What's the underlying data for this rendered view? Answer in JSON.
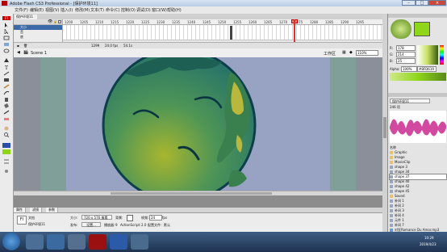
{
  "window": {
    "title": "Adobe Flash CS3 Professional - [保护环境11]"
  },
  "menu": [
    "文件(F)",
    "编辑(E)",
    "视图(V)",
    "插入(I)",
    "修改(M)",
    "文本(T)",
    "命令(C)",
    "控制(O)",
    "调试(D)",
    "窗口(W)",
    "帮助(H)"
  ],
  "document_tab": "保护环境11",
  "timeline": {
    "ticks": [
      "1200",
      "1205",
      "1210",
      "1215",
      "1220",
      "1225",
      "1230",
      "1235",
      "1240",
      "1245",
      "1250",
      "1255",
      "1260",
      "1265",
      "1270",
      "1275",
      "1280",
      "1285",
      "1290",
      "1295"
    ],
    "layers": [
      {
        "name": "大小"
      },
      {
        "name": "音"
      },
      {
        "name": "底"
      }
    ],
    "status": {
      "frame": "1299",
      "fps": "24.0 fps",
      "time": "54.1s"
    }
  },
  "editbar": {
    "scene": "Scene 1",
    "workspace": "工作区",
    "zoom": "110%"
  },
  "properties": {
    "tabs": [
      "属性",
      "滤镜",
      "参数"
    ],
    "doc_type": "文档",
    "doc_name": "保护环境11",
    "size_label": "大小:",
    "size_value": "720 x 576 像素",
    "bg_label": "背景:",
    "fps_label": "帧频:",
    "fps_value": "24",
    "fps_unit": "fps",
    "publish_label": "发布:",
    "settings_button": "设置...",
    "player_label": "播放器:",
    "player_value": "9",
    "as_label": "ActionScript:",
    "as_value": "2.0",
    "profile_label": "配置文件:",
    "profile_value": "默认"
  },
  "color": {
    "hex": "#8FD619",
    "r": "178",
    "g": "214",
    "b": "25",
    "alpha_label": "Alpha:",
    "alpha": "100%"
  },
  "library": {
    "header": "保护环境11",
    "count": "246 项",
    "name_col": "名称",
    "items": [
      "Graphic",
      "Image",
      "MovieClip",
      "shape 3",
      "shape 34",
      "shape 37",
      "shape 40",
      "shape 42",
      "shape 45",
      "Sound",
      "补间 1",
      "补间 2",
      "补间 3",
      "补间 4",
      "元件 1",
      "补间 7",
      "对狂Romance Du Amor.mp3",
      "补间 5",
      "无金属又多又 1"
    ]
  },
  "clock": {
    "time": "10:29",
    "date": "2019/4/23"
  }
}
